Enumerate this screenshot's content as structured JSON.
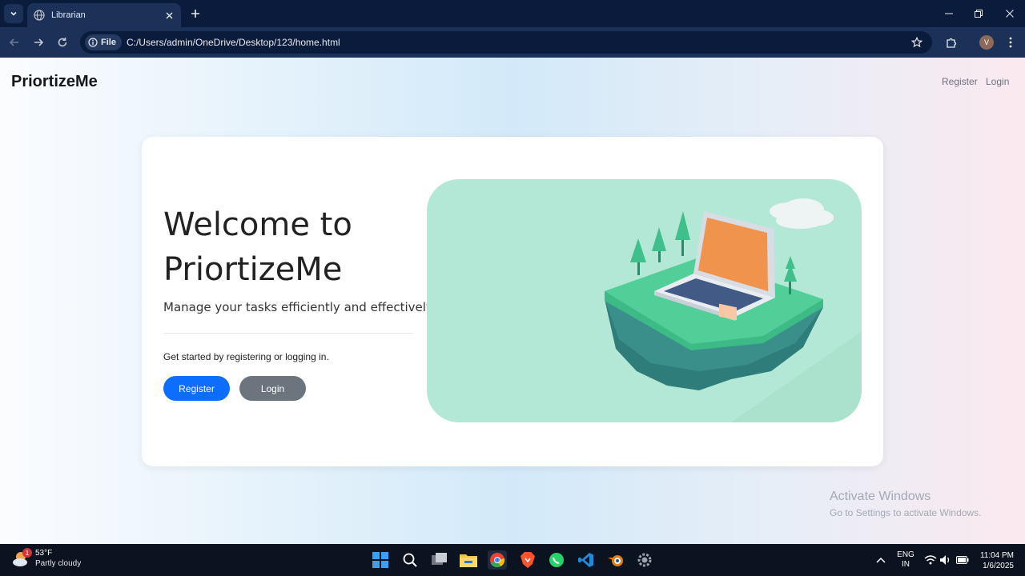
{
  "browser": {
    "tab_title": "Librarian",
    "file_chip": "File",
    "url": "C:/Users/admin/OneDrive/Desktop/123/home.html",
    "profile_initial": "V"
  },
  "nav": {
    "brand": "PriortizeMe",
    "links": [
      "Register",
      "Login"
    ]
  },
  "hero": {
    "title": "Welcome to PriortizeMe",
    "subtitle": "Manage your tasks efficiently and effectively.",
    "hint": "Get started by registering or logging in.",
    "register_label": "Register",
    "login_label": "Login"
  },
  "watermark": {
    "line1": "Activate Windows",
    "line2": "Go to Settings to activate Windows."
  },
  "taskbar": {
    "weather_temp": "53°F",
    "weather_desc": "Partly cloudy",
    "weather_badge": "1",
    "lang_line1": "ENG",
    "lang_line2": "IN",
    "time": "11:04 PM",
    "date": "1/6/2025",
    "apps": [
      "start-icon",
      "search-icon",
      "task-view-icon",
      "file-explorer-icon",
      "chrome-icon",
      "brave-icon",
      "whatsapp-icon",
      "vscode-icon",
      "blender-icon",
      "settings-icon"
    ]
  },
  "colors": {
    "primary": "#0d6efd",
    "secondary": "#6c757d",
    "illustration_bg": "#b4e8d6"
  }
}
